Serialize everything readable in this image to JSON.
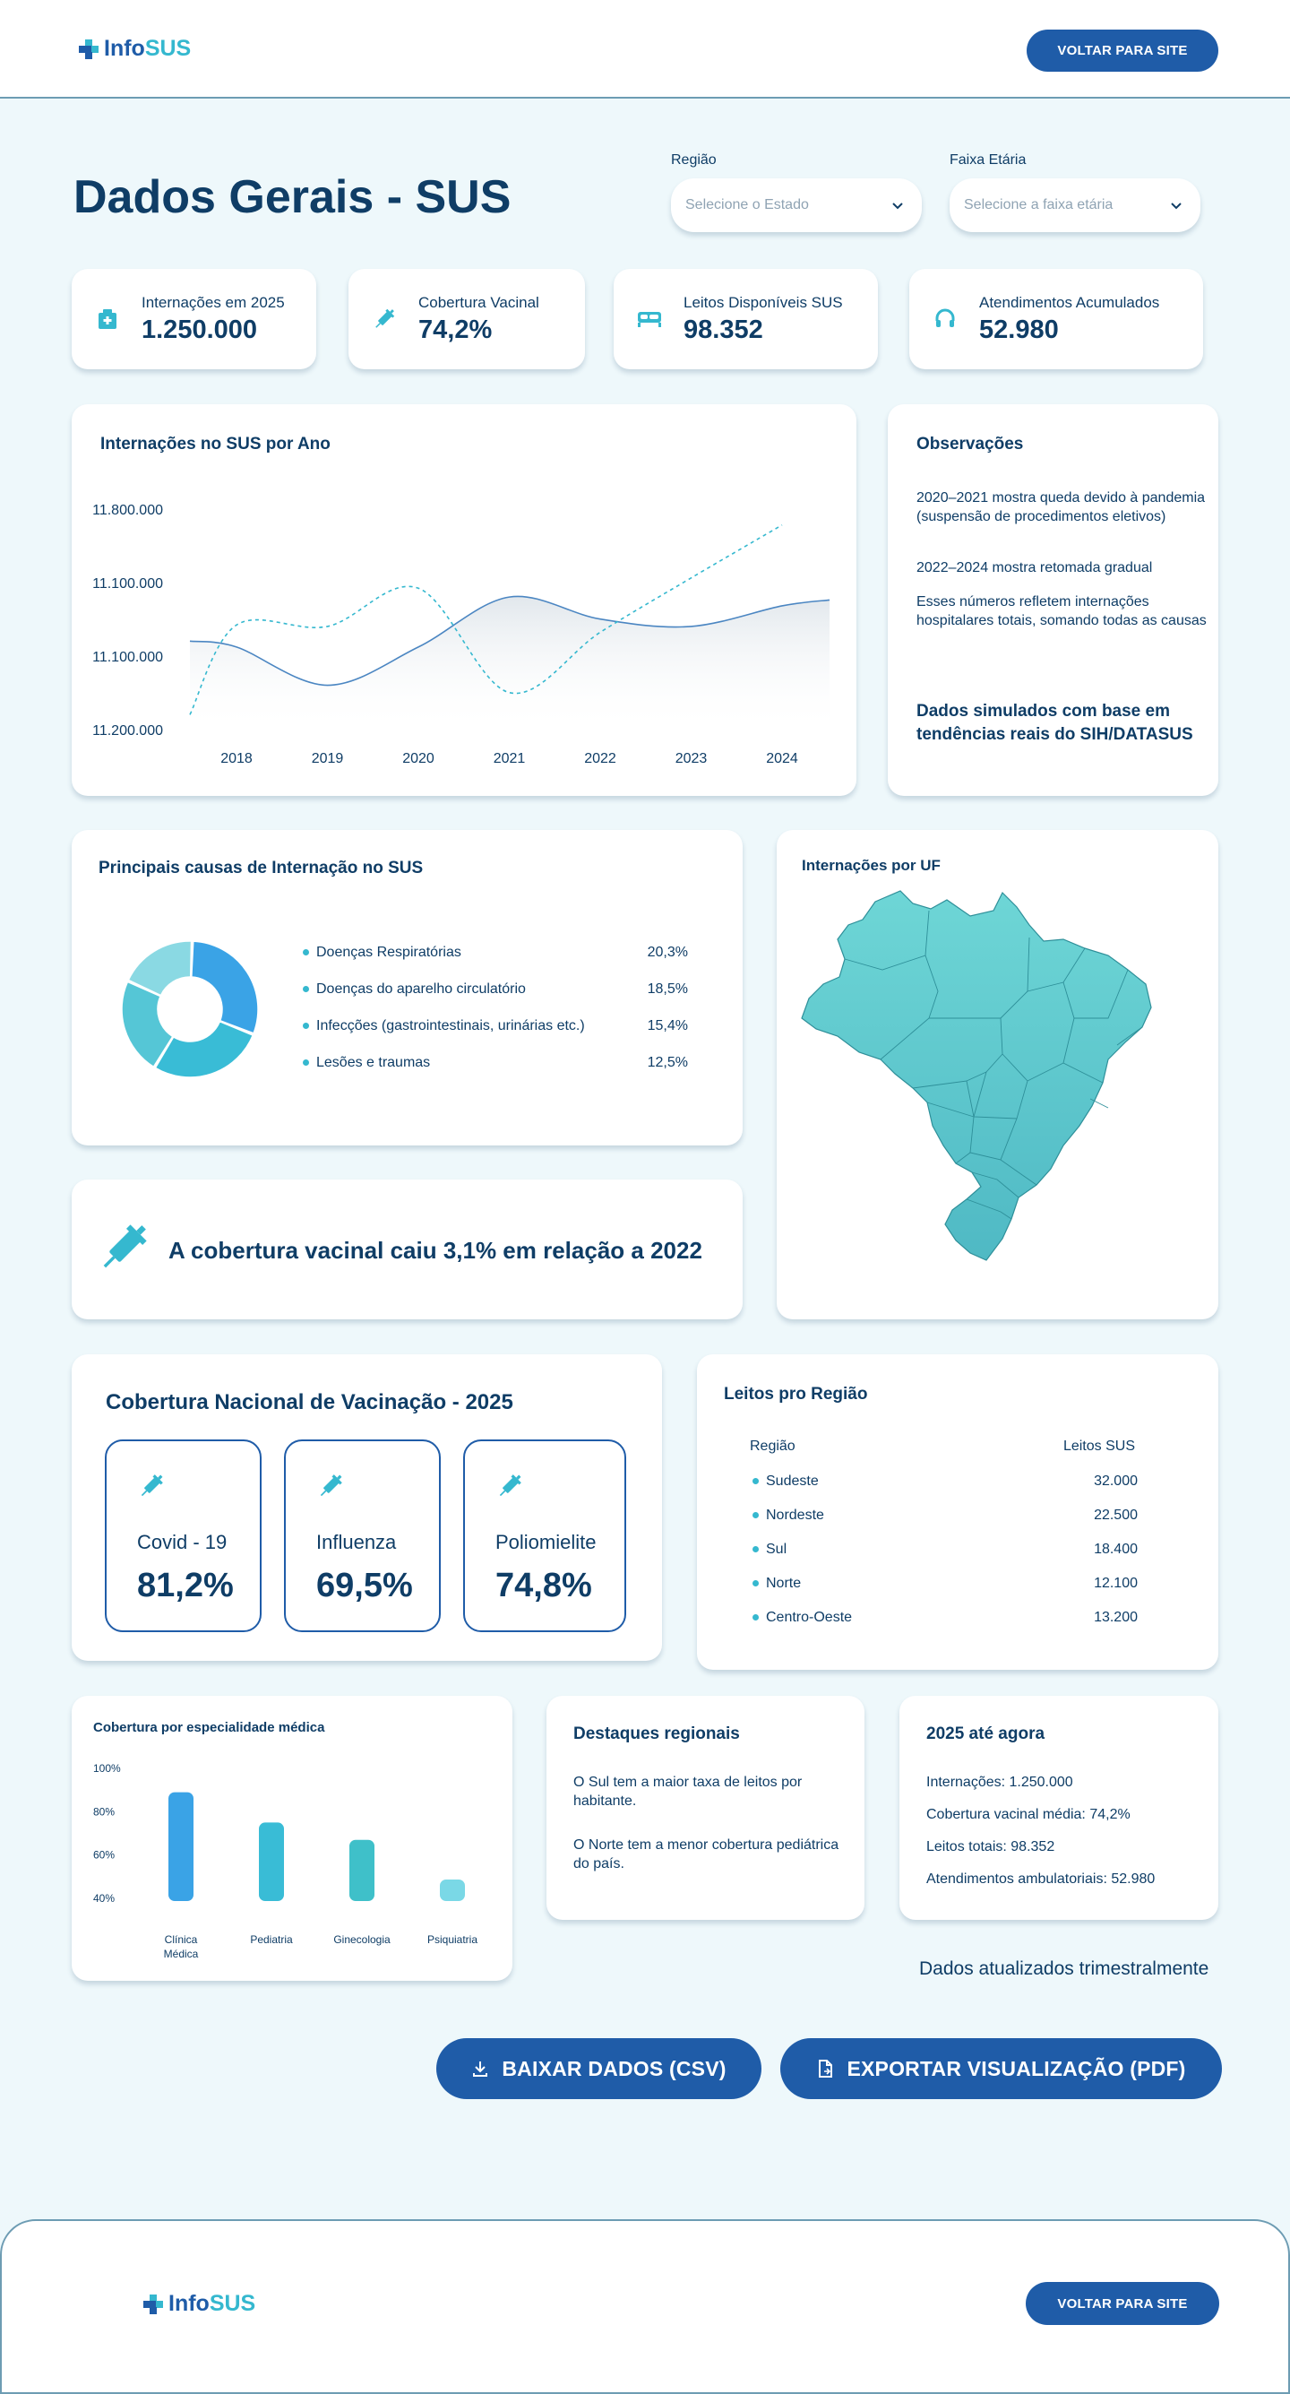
{
  "header": {
    "logo_info": "Info",
    "logo_sus": "SUS",
    "back_button": "VOLTAR PARA SITE"
  },
  "page": {
    "title": "Dados Gerais - SUS"
  },
  "filters": {
    "region_label": "Região",
    "region_placeholder": "Selecione o Estado",
    "age_label": "Faixa Etária",
    "age_placeholder": "Selecione a faixa etária"
  },
  "kpis": [
    {
      "label": "Internações em 2025",
      "value": "1.250.000",
      "icon": "hospital-icon"
    },
    {
      "label": "Cobertura Vacinal",
      "value": "74,2%",
      "icon": "syringe-icon"
    },
    {
      "label": "Leitos Disponíveis SUS",
      "value": "98.352",
      "icon": "bed-icon"
    },
    {
      "label": "Atendimentos Acumulados",
      "value": "52.980",
      "icon": "headset-icon"
    }
  ],
  "line_chart": {
    "title": "Internações no SUS por Ano",
    "y_ticks": [
      "11.800.000",
      "11.100.000",
      "11.100.000",
      "11.200.000"
    ]
  },
  "chart_data": [
    {
      "type": "line",
      "title": "Internações no SUS por Ano",
      "x": [
        "2018",
        "2019",
        "2020",
        "2021",
        "2022",
        "2023",
        "2024"
      ],
      "y_tick_labels": [
        "11.800.000",
        "11.100.000",
        "11.100.000",
        "11.200.000"
      ],
      "series": [
        {
          "values": [
            0.58,
            0.32,
            0.58,
            0.92,
            0.77,
            0.72,
            0.86
          ]
        },
        {
          "values": [
            0.73,
            0.72,
            0.98,
            0.27,
            0.68,
            1.05,
            1.41
          ]
        }
      ]
    },
    {
      "type": "pie",
      "title": "Principais causas de Internação no SUS",
      "categories": [
        "Doenças Respiratórias",
        "Doenças do aparelho circulatório",
        "Infecções (gastrointestinais, urinárias etc.)",
        "Lesões e traumas"
      ],
      "values": [
        20.3,
        18.5,
        15.4,
        12.5
      ]
    },
    {
      "type": "bar",
      "title": "Cobertura por especialidade médica",
      "categories": [
        "Clínica Médica",
        "Pediatria",
        "Ginecologia",
        "Psiquiatria"
      ],
      "values": [
        89,
        75,
        67,
        49
      ],
      "y_tick_labels": [
        "100%",
        "80%",
        "60%",
        "40%"
      ],
      "ylim": [
        40,
        100
      ]
    }
  ],
  "observations": {
    "title": "Observações",
    "items": [
      "2020–2021 mostra queda devido à pandemia (suspensão de procedimentos eletivos)",
      "2022–2024 mostra retomada gradual",
      "Esses números refletem internações hospitalares totais, somando todas as causas"
    ],
    "note": "Dados simulados com base em tendências reais do SIH/DATASUS"
  },
  "causes": {
    "title": "Principais causas de Internação no SUS",
    "items": [
      {
        "label": "Doenças Respiratórias",
        "value": "20,3%"
      },
      {
        "label": "Doenças do aparelho circulatório",
        "value": "18,5%"
      },
      {
        "label": "Infecções (gastrointestinais, urinárias etc.)",
        "value": "15,4%"
      },
      {
        "label": "Lesões e traumas",
        "value": "12,5%"
      }
    ],
    "colors": [
      "#3aa3e6",
      "#39bcd6",
      "#55c6d6",
      "#8ad9e3"
    ]
  },
  "map": {
    "title": "Internações por UF",
    "color": "#5fcfd0"
  },
  "banner": {
    "text": "A cobertura vacinal caiu 3,1% em relação a 2022"
  },
  "vaccination": {
    "title": "Cobertura Nacional de Vacinação - 2025",
    "items": [
      {
        "name": "Covid - 19",
        "value": "81,2%"
      },
      {
        "name": "Influenza",
        "value": "69,5%"
      },
      {
        "name": "Poliomielite",
        "value": "74,8%"
      }
    ]
  },
  "beds": {
    "title": "Leitos pro Região",
    "col_region": "Região",
    "col_beds": "Leitos SUS",
    "rows": [
      {
        "region": "Sudeste",
        "beds": "32.000"
      },
      {
        "region": "Nordeste",
        "beds": "22.500"
      },
      {
        "region": "Sul",
        "beds": "18.400"
      },
      {
        "region": "Norte",
        "beds": "12.100"
      },
      {
        "region": "Centro-Oeste",
        "beds": "13.200"
      }
    ]
  },
  "specialty": {
    "title": "Cobertura por especialidade médica",
    "y_ticks": [
      "100%",
      "80%",
      "60%",
      "40%"
    ],
    "categories": [
      "Clínica Médica",
      "Pediatria",
      "Ginecologia",
      "Psiquiatria"
    ],
    "colors": [
      "#3aa3e6",
      "#39bcd6",
      "#3fc0c9",
      "#7ad8e6"
    ]
  },
  "highlights": {
    "title": "Destaques regionais",
    "p1": "O Sul tem a maior taxa de leitos por habitante.",
    "p2": "O Norte tem a menor cobertura pediátrica do país."
  },
  "summary": {
    "title": "2025 até agora",
    "lines": [
      {
        "label": "Internações:",
        "value": "1.250.000"
      },
      {
        "label": "Cobertura vacinal média:",
        "value": "74,2%"
      },
      {
        "label": "Leitos totais:",
        "value": "98.352"
      },
      {
        "label": "Atendimentos ambulatoriais:",
        "value": "52.980"
      }
    ]
  },
  "updated_note": "Dados atualizados trimestralmente",
  "actions": {
    "csv": "BAIXAR DADOS (CSV)",
    "pdf": "EXPORTAR VISUALIZAÇÃO (PDF)"
  },
  "footer": {
    "logo_info": "Info",
    "logo_sus": "SUS",
    "back_button": "VOLTAR PARA SITE"
  },
  "colors": {
    "primary": "#1f5ca8",
    "accent": "#35b8cf",
    "text": "#0f3d66",
    "background": "#eef8fb"
  }
}
